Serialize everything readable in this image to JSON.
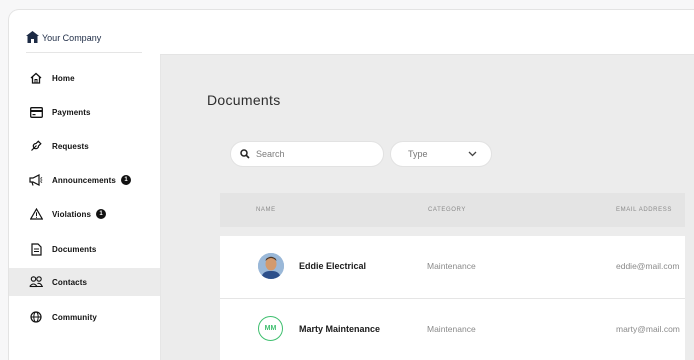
{
  "company": {
    "name": "Your Company"
  },
  "sidebar": {
    "items": [
      {
        "label": "Home",
        "icon": "home-icon",
        "active": false
      },
      {
        "label": "Payments",
        "icon": "credit-card-icon",
        "active": false
      },
      {
        "label": "Requests",
        "icon": "wrench-icon",
        "active": false
      },
      {
        "label": "Announcements",
        "icon": "megaphone-icon",
        "badge": "1",
        "active": false
      },
      {
        "label": "Violations",
        "icon": "warning-icon",
        "badge": "1",
        "active": false
      },
      {
        "label": "Documents",
        "icon": "document-icon",
        "active": false
      },
      {
        "label": "Contacts",
        "icon": "contacts-icon",
        "active": true
      },
      {
        "label": "Community",
        "icon": "globe-icon",
        "active": false
      }
    ]
  },
  "main": {
    "title": "Documents",
    "search": {
      "placeholder": "Search",
      "value": ""
    },
    "filter": {
      "label": "Type"
    },
    "table": {
      "columns": [
        "NAME",
        "CATEGORY",
        "EMAIL ADDRESS"
      ],
      "rows": [
        {
          "avatar": "photo",
          "name": "Eddie Electrical",
          "category": "Maintenance",
          "email": "eddie@mail.com"
        },
        {
          "avatar": "MM",
          "name": "Marty Maintenance",
          "category": "Maintenance",
          "email": "marty@mail.com"
        }
      ]
    }
  },
  "colors": {
    "accent_green": "#3fbf6f",
    "sidebar_active": "#ebebeb",
    "content_bg": "#ececec"
  }
}
